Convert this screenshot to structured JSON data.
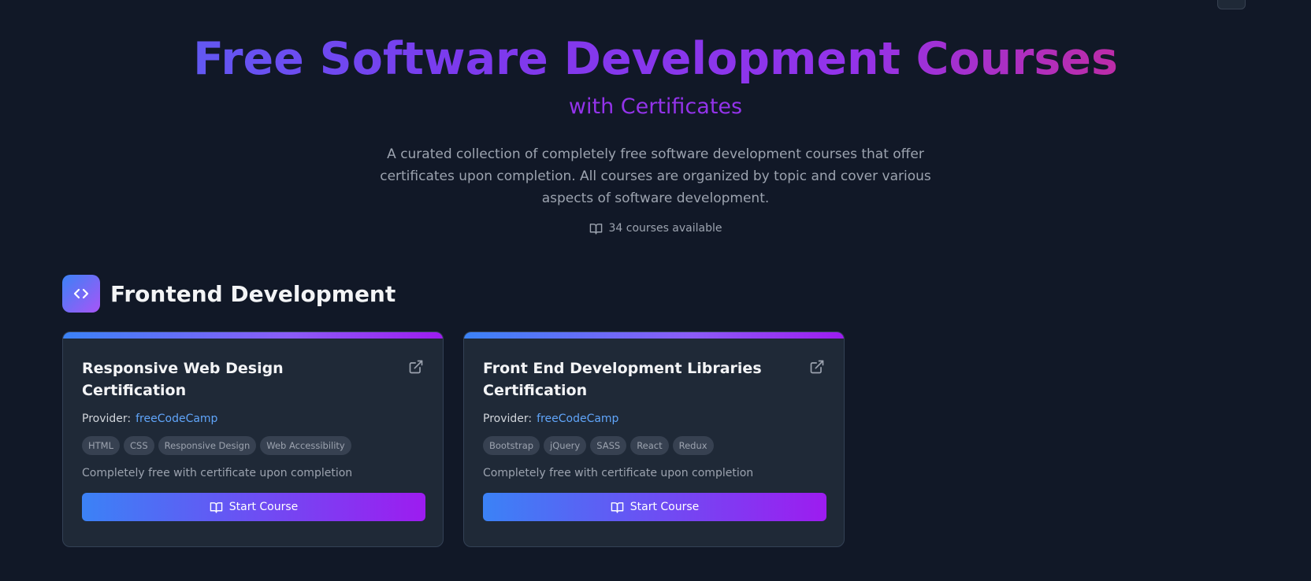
{
  "hero": {
    "title": "Free Software Development Courses",
    "subtitle": "with Certificates",
    "description": "A curated collection of completely free software development courses that offer certificates upon completion. All courses are organized by topic and cover various aspects of software development.",
    "count": "34 courses available"
  },
  "section": {
    "title": "Frontend Development",
    "icon": "code-brackets-icon"
  },
  "cards": [
    {
      "title": "Responsive Web Design Certification",
      "provider_label": "Provider:",
      "provider": "freeCodeCamp",
      "tags": [
        "HTML",
        "CSS",
        "Responsive Design",
        "Web Accessibility"
      ],
      "note": "Completely free with certificate upon completion",
      "button": "Start Course"
    },
    {
      "title": "Front End Development Libraries Certification",
      "provider_label": "Provider:",
      "provider": "freeCodeCamp",
      "tags": [
        "Bootstrap",
        "jQuery",
        "SASS",
        "React",
        "Redux"
      ],
      "note": "Completely free with certificate upon completion",
      "button": "Start Course"
    }
  ],
  "colors": {
    "background": "#111827",
    "card": "#1f2937",
    "accent_blue": "#3b82f6",
    "accent_purple": "#9333ea",
    "link": "#60a5fa"
  }
}
